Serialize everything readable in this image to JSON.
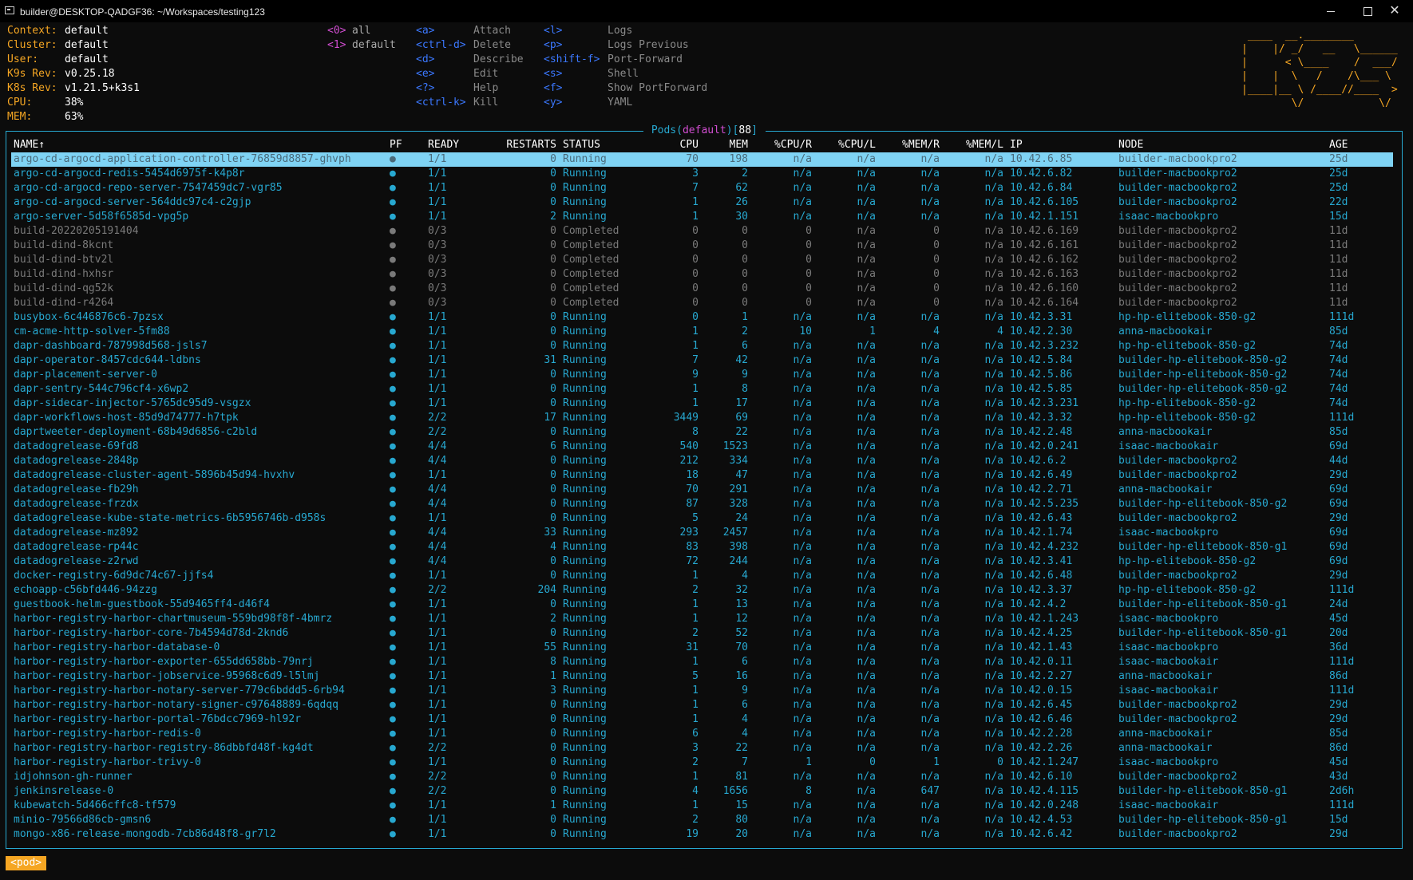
{
  "window": {
    "title": "builder@DESKTOP-QADGF36: ~/Workspaces/testing123",
    "close_glyph": "✕"
  },
  "info": [
    {
      "label": "Context:",
      "value": "default"
    },
    {
      "label": "Cluster:",
      "value": "default"
    },
    {
      "label": "User:",
      "value": "default"
    },
    {
      "label": "K9s Rev:",
      "value": "v0.25.18"
    },
    {
      "label": "K8s Rev:",
      "value": "v1.21.5+k3s1"
    },
    {
      "label": "CPU:",
      "value": "38%"
    },
    {
      "label": "MEM:",
      "value": "63%"
    }
  ],
  "namespaces": [
    {
      "key": "<0>",
      "name": "all"
    },
    {
      "key": "<1>",
      "name": "default"
    }
  ],
  "hotkeys_left": [
    {
      "key": "<a>",
      "desc": "Attach"
    },
    {
      "key": "<ctrl-d>",
      "desc": "Delete"
    },
    {
      "key": "<d>",
      "desc": "Describe"
    },
    {
      "key": "<e>",
      "desc": "Edit"
    },
    {
      "key": "<?>",
      "desc": "Help"
    },
    {
      "key": "<ctrl-k>",
      "desc": "Kill"
    }
  ],
  "hotkeys_right": [
    {
      "key": "<l>",
      "desc": "Logs"
    },
    {
      "key": "<p>",
      "desc": "Logs Previous"
    },
    {
      "key": "<shift-f>",
      "desc": "Port-Forward"
    },
    {
      "key": "<s>",
      "desc": "Shell"
    },
    {
      "key": "<f>",
      "desc": "Show PortForward"
    },
    {
      "key": "<y>",
      "desc": "YAML"
    }
  ],
  "logo_lines": [
    " ____  __.________       ",
    "|    |/ _/   __   \\______",
    "|      < \\____    /  ___/",
    "|    |  \\   /    /\\___ \\ ",
    "|____|__ \\ /____//____  >",
    "        \\/            \\/ "
  ],
  "panel": {
    "title_prefix": " Pods(",
    "namespace": "default",
    "title_mid": ")[",
    "count": "88",
    "title_suffix": "] "
  },
  "colors": {
    "accent": "#27a8d0",
    "label": "#f5a623",
    "namespace": "#d24ed2",
    "hotkey": "#3b78ff",
    "selected_bg": "#7fd3f4"
  },
  "columns": [
    "NAME↑",
    "PF",
    "READY",
    "RESTARTS",
    "STATUS",
    "CPU",
    "MEM",
    "%CPU/R",
    "%CPU/L",
    "%MEM/R",
    "%MEM/L",
    "IP",
    "NODE",
    "AGE"
  ],
  "selected_index": 0,
  "pods": [
    [
      "argo-cd-argocd-application-controller-76859d8857-ghvph",
      "●",
      "1/1",
      "0",
      "Running",
      "70",
      "198",
      "n/a",
      "n/a",
      "n/a",
      "n/a",
      "10.42.6.85",
      "builder-macbookpro2",
      "25d"
    ],
    [
      "argo-cd-argocd-redis-5454d6975f-k4p8r",
      "●",
      "1/1",
      "0",
      "Running",
      "3",
      "2",
      "n/a",
      "n/a",
      "n/a",
      "n/a",
      "10.42.6.82",
      "builder-macbookpro2",
      "25d"
    ],
    [
      "argo-cd-argocd-repo-server-7547459dc7-vgr85",
      "●",
      "1/1",
      "0",
      "Running",
      "7",
      "62",
      "n/a",
      "n/a",
      "n/a",
      "n/a",
      "10.42.6.84",
      "builder-macbookpro2",
      "25d"
    ],
    [
      "argo-cd-argocd-server-564ddc97c4-c2gjp",
      "●",
      "1/1",
      "0",
      "Running",
      "1",
      "26",
      "n/a",
      "n/a",
      "n/a",
      "n/a",
      "10.42.6.105",
      "builder-macbookpro2",
      "22d"
    ],
    [
      "argo-server-5d58f6585d-vpg5p",
      "●",
      "1/1",
      "2",
      "Running",
      "1",
      "30",
      "n/a",
      "n/a",
      "n/a",
      "n/a",
      "10.42.1.151",
      "isaac-macbookpro",
      "15d"
    ],
    [
      "build-20220205191404",
      "●",
      "0/3",
      "0",
      "Completed",
      "0",
      "0",
      "0",
      "n/a",
      "0",
      "n/a",
      "10.42.6.169",
      "builder-macbookpro2",
      "11d"
    ],
    [
      "build-dind-8kcnt",
      "●",
      "0/3",
      "0",
      "Completed",
      "0",
      "0",
      "0",
      "n/a",
      "0",
      "n/a",
      "10.42.6.161",
      "builder-macbookpro2",
      "11d"
    ],
    [
      "build-dind-btv2l",
      "●",
      "0/3",
      "0",
      "Completed",
      "0",
      "0",
      "0",
      "n/a",
      "0",
      "n/a",
      "10.42.6.162",
      "builder-macbookpro2",
      "11d"
    ],
    [
      "build-dind-hxhsr",
      "●",
      "0/3",
      "0",
      "Completed",
      "0",
      "0",
      "0",
      "n/a",
      "0",
      "n/a",
      "10.42.6.163",
      "builder-macbookpro2",
      "11d"
    ],
    [
      "build-dind-qg52k",
      "●",
      "0/3",
      "0",
      "Completed",
      "0",
      "0",
      "0",
      "n/a",
      "0",
      "n/a",
      "10.42.6.160",
      "builder-macbookpro2",
      "11d"
    ],
    [
      "build-dind-r4264",
      "●",
      "0/3",
      "0",
      "Completed",
      "0",
      "0",
      "0",
      "n/a",
      "0",
      "n/a",
      "10.42.6.164",
      "builder-macbookpro2",
      "11d"
    ],
    [
      "busybox-6c446876c6-7pzsx",
      "●",
      "1/1",
      "0",
      "Running",
      "0",
      "1",
      "n/a",
      "n/a",
      "n/a",
      "n/a",
      "10.42.3.31",
      "hp-hp-elitebook-850-g2",
      "111d"
    ],
    [
      "cm-acme-http-solver-5fm88",
      "●",
      "1/1",
      "0",
      "Running",
      "1",
      "2",
      "10",
      "1",
      "4",
      "4",
      "10.42.2.30",
      "anna-macbookair",
      "85d"
    ],
    [
      "dapr-dashboard-787998d568-jsls7",
      "●",
      "1/1",
      "0",
      "Running",
      "1",
      "6",
      "n/a",
      "n/a",
      "n/a",
      "n/a",
      "10.42.3.232",
      "hp-hp-elitebook-850-g2",
      "74d"
    ],
    [
      "dapr-operator-8457cdc644-ldbns",
      "●",
      "1/1",
      "31",
      "Running",
      "7",
      "42",
      "n/a",
      "n/a",
      "n/a",
      "n/a",
      "10.42.5.84",
      "builder-hp-elitebook-850-g2",
      "74d"
    ],
    [
      "dapr-placement-server-0",
      "●",
      "1/1",
      "0",
      "Running",
      "9",
      "9",
      "n/a",
      "n/a",
      "n/a",
      "n/a",
      "10.42.5.86",
      "builder-hp-elitebook-850-g2",
      "74d"
    ],
    [
      "dapr-sentry-544c796cf4-x6wp2",
      "●",
      "1/1",
      "0",
      "Running",
      "1",
      "8",
      "n/a",
      "n/a",
      "n/a",
      "n/a",
      "10.42.5.85",
      "builder-hp-elitebook-850-g2",
      "74d"
    ],
    [
      "dapr-sidecar-injector-5765dc95d9-vsgzx",
      "●",
      "1/1",
      "0",
      "Running",
      "1",
      "17",
      "n/a",
      "n/a",
      "n/a",
      "n/a",
      "10.42.3.231",
      "hp-hp-elitebook-850-g2",
      "74d"
    ],
    [
      "dapr-workflows-host-85d9d74777-h7tpk",
      "●",
      "2/2",
      "17",
      "Running",
      "3449",
      "69",
      "n/a",
      "n/a",
      "n/a",
      "n/a",
      "10.42.3.32",
      "hp-hp-elitebook-850-g2",
      "111d"
    ],
    [
      "daprtweeter-deployment-68b49d6856-c2bld",
      "●",
      "2/2",
      "0",
      "Running",
      "8",
      "22",
      "n/a",
      "n/a",
      "n/a",
      "n/a",
      "10.42.2.48",
      "anna-macbookair",
      "85d"
    ],
    [
      "datadogrelease-69fd8",
      "●",
      "4/4",
      "6",
      "Running",
      "540",
      "1523",
      "n/a",
      "n/a",
      "n/a",
      "n/a",
      "10.42.0.241",
      "isaac-macbookair",
      "69d"
    ],
    [
      "datadogrelease-2848p",
      "●",
      "4/4",
      "0",
      "Running",
      "212",
      "334",
      "n/a",
      "n/a",
      "n/a",
      "n/a",
      "10.42.6.2",
      "builder-macbookpro2",
      "44d"
    ],
    [
      "datadogrelease-cluster-agent-5896b45d94-hvxhv",
      "●",
      "1/1",
      "0",
      "Running",
      "18",
      "47",
      "n/a",
      "n/a",
      "n/a",
      "n/a",
      "10.42.6.49",
      "builder-macbookpro2",
      "29d"
    ],
    [
      "datadogrelease-fb29h",
      "●",
      "4/4",
      "0",
      "Running",
      "70",
      "291",
      "n/a",
      "n/a",
      "n/a",
      "n/a",
      "10.42.2.71",
      "anna-macbookair",
      "69d"
    ],
    [
      "datadogrelease-frzdx",
      "●",
      "4/4",
      "0",
      "Running",
      "87",
      "328",
      "n/a",
      "n/a",
      "n/a",
      "n/a",
      "10.42.5.235",
      "builder-hp-elitebook-850-g2",
      "69d"
    ],
    [
      "datadogrelease-kube-state-metrics-6b5956746b-d958s",
      "●",
      "1/1",
      "0",
      "Running",
      "5",
      "24",
      "n/a",
      "n/a",
      "n/a",
      "n/a",
      "10.42.6.43",
      "builder-macbookpro2",
      "29d"
    ],
    [
      "datadogrelease-mz892",
      "●",
      "4/4",
      "33",
      "Running",
      "293",
      "2457",
      "n/a",
      "n/a",
      "n/a",
      "n/a",
      "10.42.1.74",
      "isaac-macbookpro",
      "69d"
    ],
    [
      "datadogrelease-rp44c",
      "●",
      "4/4",
      "4",
      "Running",
      "83",
      "398",
      "n/a",
      "n/a",
      "n/a",
      "n/a",
      "10.42.4.232",
      "builder-hp-elitebook-850-g1",
      "69d"
    ],
    [
      "datadogrelease-z2rwd",
      "●",
      "4/4",
      "0",
      "Running",
      "72",
      "244",
      "n/a",
      "n/a",
      "n/a",
      "n/a",
      "10.42.3.41",
      "hp-hp-elitebook-850-g2",
      "69d"
    ],
    [
      "docker-registry-6d9dc74c67-jjfs4",
      "●",
      "1/1",
      "0",
      "Running",
      "1",
      "4",
      "n/a",
      "n/a",
      "n/a",
      "n/a",
      "10.42.6.48",
      "builder-macbookpro2",
      "29d"
    ],
    [
      "echoapp-c56bfd446-94zzg",
      "●",
      "2/2",
      "204",
      "Running",
      "2",
      "32",
      "n/a",
      "n/a",
      "n/a",
      "n/a",
      "10.42.3.37",
      "hp-hp-elitebook-850-g2",
      "111d"
    ],
    [
      "guestbook-helm-guestbook-55d9465ff4-d46f4",
      "●",
      "1/1",
      "0",
      "Running",
      "1",
      "13",
      "n/a",
      "n/a",
      "n/a",
      "n/a",
      "10.42.4.2",
      "builder-hp-elitebook-850-g1",
      "24d"
    ],
    [
      "harbor-registry-harbor-chartmuseum-559bd98f8f-4bmrz",
      "●",
      "1/1",
      "2",
      "Running",
      "1",
      "12",
      "n/a",
      "n/a",
      "n/a",
      "n/a",
      "10.42.1.243",
      "isaac-macbookpro",
      "45d"
    ],
    [
      "harbor-registry-harbor-core-7b4594d78d-2knd6",
      "●",
      "1/1",
      "0",
      "Running",
      "2",
      "52",
      "n/a",
      "n/a",
      "n/a",
      "n/a",
      "10.42.4.25",
      "builder-hp-elitebook-850-g1",
      "20d"
    ],
    [
      "harbor-registry-harbor-database-0",
      "●",
      "1/1",
      "55",
      "Running",
      "31",
      "70",
      "n/a",
      "n/a",
      "n/a",
      "n/a",
      "10.42.1.43",
      "isaac-macbookpro",
      "36d"
    ],
    [
      "harbor-registry-harbor-exporter-655dd658bb-79nrj",
      "●",
      "1/1",
      "8",
      "Running",
      "1",
      "6",
      "n/a",
      "n/a",
      "n/a",
      "n/a",
      "10.42.0.11",
      "isaac-macbookair",
      "111d"
    ],
    [
      "harbor-registry-harbor-jobservice-95968c6d9-l5lmj",
      "●",
      "1/1",
      "1",
      "Running",
      "5",
      "16",
      "n/a",
      "n/a",
      "n/a",
      "n/a",
      "10.42.2.27",
      "anna-macbookair",
      "86d"
    ],
    [
      "harbor-registry-harbor-notary-server-779c6bddd5-6rb94",
      "●",
      "1/1",
      "3",
      "Running",
      "1",
      "9",
      "n/a",
      "n/a",
      "n/a",
      "n/a",
      "10.42.0.15",
      "isaac-macbookair",
      "111d"
    ],
    [
      "harbor-registry-harbor-notary-signer-c97648889-6qdqq",
      "●",
      "1/1",
      "0",
      "Running",
      "1",
      "6",
      "n/a",
      "n/a",
      "n/a",
      "n/a",
      "10.42.6.45",
      "builder-macbookpro2",
      "29d"
    ],
    [
      "harbor-registry-harbor-portal-76bdcc7969-hl92r",
      "●",
      "1/1",
      "0",
      "Running",
      "1",
      "4",
      "n/a",
      "n/a",
      "n/a",
      "n/a",
      "10.42.6.46",
      "builder-macbookpro2",
      "29d"
    ],
    [
      "harbor-registry-harbor-redis-0",
      "●",
      "1/1",
      "0",
      "Running",
      "6",
      "4",
      "n/a",
      "n/a",
      "n/a",
      "n/a",
      "10.42.2.28",
      "anna-macbookair",
      "85d"
    ],
    [
      "harbor-registry-harbor-registry-86dbbfd48f-kg4dt",
      "●",
      "2/2",
      "0",
      "Running",
      "3",
      "22",
      "n/a",
      "n/a",
      "n/a",
      "n/a",
      "10.42.2.26",
      "anna-macbookair",
      "86d"
    ],
    [
      "harbor-registry-harbor-trivy-0",
      "●",
      "1/1",
      "0",
      "Running",
      "2",
      "7",
      "1",
      "0",
      "1",
      "0",
      "10.42.1.247",
      "isaac-macbookpro",
      "45d"
    ],
    [
      "idjohnson-gh-runner",
      "●",
      "2/2",
      "0",
      "Running",
      "1",
      "81",
      "n/a",
      "n/a",
      "n/a",
      "n/a",
      "10.42.6.10",
      "builder-macbookpro2",
      "43d"
    ],
    [
      "jenkinsrelease-0",
      "●",
      "2/2",
      "0",
      "Running",
      "4",
      "1656",
      "8",
      "n/a",
      "647",
      "n/a",
      "10.42.4.115",
      "builder-hp-elitebook-850-g1",
      "2d6h"
    ],
    [
      "kubewatch-5d466cffc8-tf579",
      "●",
      "1/1",
      "1",
      "Running",
      "1",
      "15",
      "n/a",
      "n/a",
      "n/a",
      "n/a",
      "10.42.0.248",
      "isaac-macbookair",
      "111d"
    ],
    [
      "minio-79566d86cb-gmsn6",
      "●",
      "1/1",
      "0",
      "Running",
      "2",
      "80",
      "n/a",
      "n/a",
      "n/a",
      "n/a",
      "10.42.4.53",
      "builder-hp-elitebook-850-g1",
      "15d"
    ],
    [
      "mongo-x86-release-mongodb-7cb86d48f8-gr7l2",
      "●",
      "1/1",
      "0",
      "Running",
      "19",
      "20",
      "n/a",
      "n/a",
      "n/a",
      "n/a",
      "10.42.6.42",
      "builder-macbookpro2",
      "29d"
    ]
  ],
  "breadcrumb": "<pod>"
}
